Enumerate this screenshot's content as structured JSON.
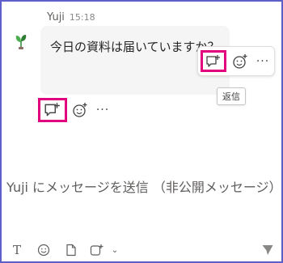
{
  "message": {
    "sender": "Yuji",
    "time": "15:18",
    "text": "今日の資料は届いていますか？"
  },
  "hover_actions": {
    "reply_icon": "reply-bubble-icon",
    "emoji_icon": "emoji-add-icon",
    "more_label": "···"
  },
  "tooltip": {
    "label": "返信"
  },
  "row_actions": {
    "more_label": "···"
  },
  "compose": {
    "placeholder": "Yuji にメッセージを送信 （非公開メッセージ）"
  },
  "toolbar": {
    "format_label": "T",
    "chevron_label": "⌄"
  },
  "colors": {
    "highlight": "#e3007f",
    "frame": "#5b5fc7",
    "bubble": "#f5f5f5"
  }
}
